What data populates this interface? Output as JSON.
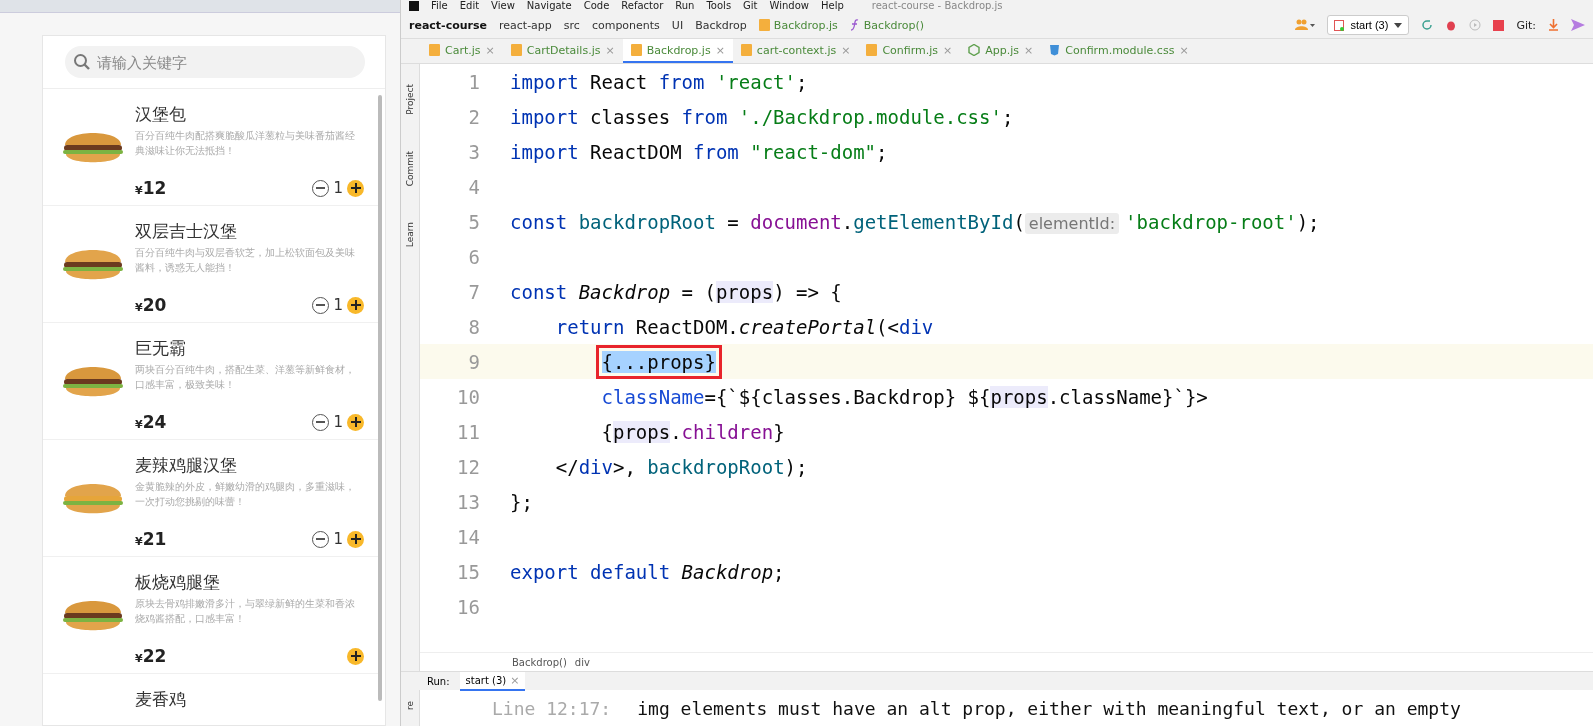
{
  "shop": {
    "search": {
      "placeholder": "请输入关键字"
    },
    "items": [
      {
        "name": "汉堡包",
        "desc": "百分百纯牛肉配搭爽脆酸瓜洋葱粒与美味番茄酱经典滋味让你无法抵挡！",
        "currency": "¥",
        "price": "12",
        "count": "1"
      },
      {
        "name": "双层吉士汉堡",
        "desc": "百分百纯牛肉与双层香软芝，加上松软面包及美味酱料，诱惑无人能挡！",
        "currency": "¥",
        "price": "20",
        "count": "1"
      },
      {
        "name": "巨无霸",
        "desc": "两块百分百纯牛肉，搭配生菜、洋葱等新鲜食材，口感丰富，极致美味！",
        "currency": "¥",
        "price": "24",
        "count": "1"
      },
      {
        "name": "麦辣鸡腿汉堡",
        "desc": "金黄脆辣的外皮，鲜嫩幼滑的鸡腿肉，多重滋味，一次打动您挑剔的味蕾！",
        "currency": "¥",
        "price": "21",
        "count": "1"
      },
      {
        "name": "板烧鸡腿堡",
        "desc": "原块去骨鸡排嫩滑多汁，与翠绿新鲜的生菜和香浓烧鸡酱搭配，口感丰富！",
        "currency": "¥",
        "price": "22"
      },
      {
        "name": "麦香鸡"
      }
    ]
  },
  "ide": {
    "menu": [
      "File",
      "Edit",
      "View",
      "Navigate",
      "Code",
      "Refactor",
      "Run",
      "Tools",
      "Git",
      "Window",
      "Help"
    ],
    "title": "react-course - Backdrop.js",
    "navbar": [
      {
        "label": "react-course",
        "kind": "root"
      },
      {
        "label": "react-app",
        "kind": "dir"
      },
      {
        "label": "src",
        "kind": "dir"
      },
      {
        "label": "components",
        "kind": "dir"
      },
      {
        "label": "UI",
        "kind": "dir"
      },
      {
        "label": "Backdrop",
        "kind": "dir"
      },
      {
        "label": "Backdrop.js",
        "kind": "file"
      },
      {
        "label": "Backdrop()",
        "kind": "function"
      }
    ],
    "run_config": "start (3)",
    "git_label": "Git:",
    "tool_tabs": [
      "Project",
      "Commit",
      "Learn"
    ],
    "bottom_tool_tab": "re",
    "tabs": [
      {
        "label": "Cart.js",
        "kind": "js",
        "selected": false,
        "close": "×"
      },
      {
        "label": "CartDetails.js",
        "kind": "js",
        "selected": false,
        "close": "×"
      },
      {
        "label": "Backdrop.js",
        "kind": "js",
        "selected": true,
        "close": "×"
      },
      {
        "label": "cart-context.js",
        "kind": "js",
        "selected": false,
        "close": "×"
      },
      {
        "label": "Confirm.js",
        "kind": "js",
        "selected": false,
        "close": "×"
      },
      {
        "label": "App.js",
        "kind": "node",
        "selected": false,
        "close": "×"
      },
      {
        "label": "Confirm.module.css",
        "kind": "css",
        "selected": false,
        "close": "×"
      }
    ],
    "code": [
      {
        "number": "1",
        "current": false,
        "tokens": [
          {
            "text": "import ",
            "kind": "keyword"
          },
          {
            "text": "React ",
            "kind": "plain"
          },
          {
            "text": "from ",
            "kind": "keyword"
          },
          {
            "text": "'react'",
            "kind": "string"
          },
          {
            "text": ";",
            "kind": "plain"
          }
        ]
      },
      {
        "number": "2",
        "current": false,
        "tokens": [
          {
            "text": "import ",
            "kind": "keyword"
          },
          {
            "text": "classes ",
            "kind": "plain"
          },
          {
            "text": "from ",
            "kind": "keyword"
          },
          {
            "text": "'./Backdrop.module.css'",
            "kind": "string"
          },
          {
            "text": ";",
            "kind": "plain"
          }
        ]
      },
      {
        "number": "3",
        "current": false,
        "tokens": [
          {
            "text": "import ",
            "kind": "keyword"
          },
          {
            "text": "ReactDOM ",
            "kind": "plain"
          },
          {
            "text": "from ",
            "kind": "keyword"
          },
          {
            "text": "\"react-dom\"",
            "kind": "string"
          },
          {
            "text": ";",
            "kind": "plain"
          }
        ]
      },
      {
        "number": "4",
        "current": false
      },
      {
        "number": "5",
        "current": false,
        "tokens": [
          {
            "text": "const ",
            "kind": "keyword"
          },
          {
            "text": "backdropRoot",
            "kind": "variable"
          },
          {
            "text": " = ",
            "kind": "plain"
          },
          {
            "text": "document",
            "kind": "field"
          },
          {
            "text": ".",
            "kind": "plain"
          },
          {
            "text": "getElementById",
            "kind": "call"
          },
          {
            "text": "(",
            "kind": "plain"
          },
          {
            "text": "elementId:",
            "kind": "hint"
          },
          {
            "text": "'backdrop-root'",
            "kind": "string"
          },
          {
            "text": ");",
            "kind": "plain"
          }
        ]
      },
      {
        "number": "6",
        "current": false
      },
      {
        "number": "7",
        "current": false,
        "tokens": [
          {
            "text": "const ",
            "kind": "keyword"
          },
          {
            "text": "Backdrop",
            "kind": "italic"
          },
          {
            "text": " = (",
            "kind": "plain"
          },
          {
            "text": "props",
            "kind": "param"
          },
          {
            "text": ") => {",
            "kind": "plain"
          }
        ]
      },
      {
        "number": "8",
        "current": false,
        "tokens": [
          {
            "text": "    return ",
            "kind": "keyword"
          },
          {
            "text": "ReactDOM.",
            "kind": "plain"
          },
          {
            "text": "createPortal",
            "kind": "italic"
          },
          {
            "text": "(<",
            "kind": "plain"
          },
          {
            "text": "div",
            "kind": "keyword"
          }
        ]
      },
      {
        "number": "9",
        "current": true,
        "kind": "nested",
        "tokens": [
          {
            "text": "{...props}",
            "kind": "boxed"
          }
        ]
      },
      {
        "number": "10",
        "current": false,
        "kind": "nested",
        "tokens": [
          {
            "text": "className",
            "kind": "attr"
          },
          {
            "text": "={`${",
            "kind": "plain"
          },
          {
            "text": "classes.Backdrop",
            "kind": "plain"
          },
          {
            "text": "} ${",
            "kind": "plain"
          },
          {
            "text": "props",
            "kind": "param"
          },
          {
            "text": ".className",
            "kind": "plain"
          },
          {
            "text": "}`}>",
            "kind": "plain"
          }
        ]
      },
      {
        "number": "11",
        "current": false,
        "tokens": [
          {
            "text": "        {",
            "kind": "plain"
          },
          {
            "text": "props",
            "kind": "param"
          },
          {
            "text": ".",
            "kind": "plain"
          },
          {
            "text": "children",
            "kind": "field"
          },
          {
            "text": "}",
            "kind": "plain"
          }
        ]
      },
      {
        "number": "12",
        "current": false,
        "tokens": [
          {
            "text": "    </",
            "kind": "plain"
          },
          {
            "text": "div",
            "kind": "keyword"
          },
          {
            "text": ">, ",
            "kind": "plain"
          },
          {
            "text": "backdropRoot",
            "kind": "variable"
          },
          {
            "text": ");",
            "kind": "plain"
          }
        ]
      },
      {
        "number": "13",
        "current": false,
        "tokens": [
          {
            "text": "};",
            "kind": "plain"
          }
        ]
      },
      {
        "number": "14",
        "current": false
      },
      {
        "number": "15",
        "current": false,
        "tokens": [
          {
            "text": "export default ",
            "kind": "keyword"
          },
          {
            "text": "Backdrop",
            "kind": "italic"
          },
          {
            "text": ";",
            "kind": "plain"
          }
        ]
      },
      {
        "number": "16",
        "current": false
      }
    ],
    "breadcrumb": [
      "Backdrop()",
      "div"
    ],
    "run": {
      "label": "Run:",
      "tab": "start (3)",
      "close": "×"
    },
    "console": {
      "location": "Line 12:17:",
      "message": "img elements must have an alt prop, either with meaningful text, or an empty"
    }
  }
}
